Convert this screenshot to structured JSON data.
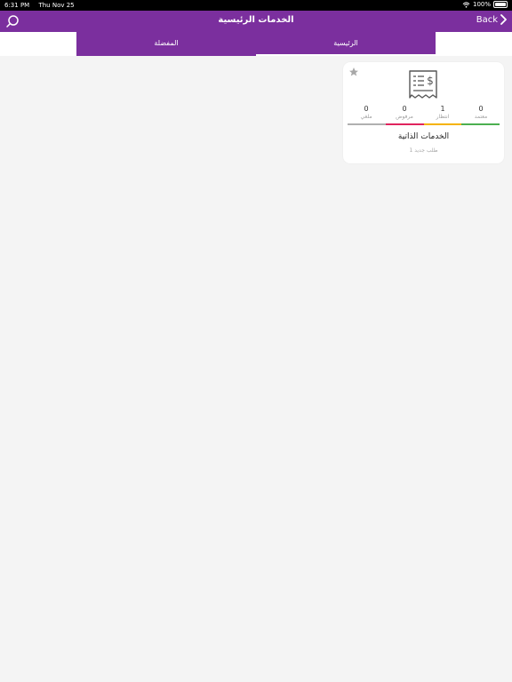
{
  "status_bar": {
    "time": "6:31 PM",
    "date": "Thu Nov 25",
    "battery": "100%"
  },
  "navbar": {
    "title": "الخدمات الرئيسية",
    "back_label": "Back"
  },
  "tabs": {
    "favorites": "المفضلة",
    "main": "الرئيسية"
  },
  "card": {
    "name": "الخدمات الذاتية",
    "subtitle": "1 طلب جديد",
    "stats": [
      {
        "value": "0",
        "label": "معتمد",
        "color": "#4caf50"
      },
      {
        "value": "1",
        "label": "انتظار",
        "color": "#f5b301"
      },
      {
        "value": "0",
        "label": "مرفوض",
        "color": "#e0245e"
      },
      {
        "value": "0",
        "label": "ملغي",
        "color": "#b0b0b0"
      }
    ],
    "star_icon": "star-icon",
    "receipt_icon": "receipt-dollar-icon"
  },
  "colors": {
    "primary": "#7b2f9e",
    "background": "#f4f4f4"
  }
}
